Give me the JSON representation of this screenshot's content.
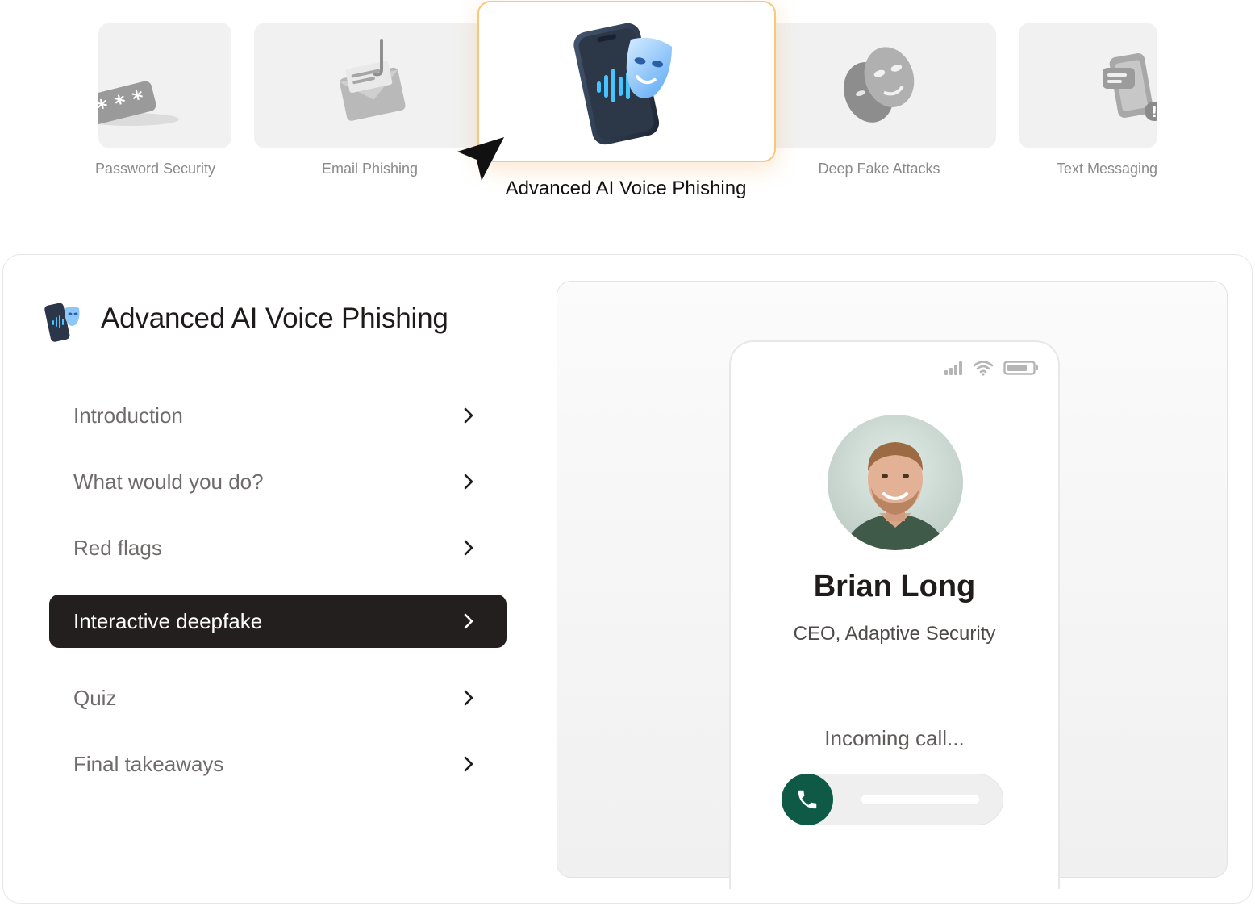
{
  "carousel": {
    "cards": [
      {
        "label": "Password Security",
        "icon": "password-icon"
      },
      {
        "label": "Email Phishing",
        "icon": "envelope-hook-icon"
      },
      {
        "label": "Advanced AI Voice Phishing",
        "icon": "phone-mask-icon",
        "active": true
      },
      {
        "label": "Deep Fake Attacks",
        "icon": "masks-icon"
      },
      {
        "label": "Text Messaging",
        "icon": "phone-messages-icon"
      }
    ]
  },
  "module": {
    "title": "Advanced AI Voice Phishing",
    "menu": [
      {
        "label": "Introduction"
      },
      {
        "label": "What would you do?"
      },
      {
        "label": "Red flags"
      },
      {
        "label": "Interactive deepfake",
        "active": true
      },
      {
        "label": "Quiz"
      },
      {
        "label": "Final takeaways"
      }
    ]
  },
  "call": {
    "name": "Brian Long",
    "role": "CEO, Adaptive Security",
    "status": "Incoming call..."
  },
  "colors": {
    "accent_dark": "#221f1e",
    "call_green": "#0f5a46",
    "active_border": "#f6c77d"
  }
}
